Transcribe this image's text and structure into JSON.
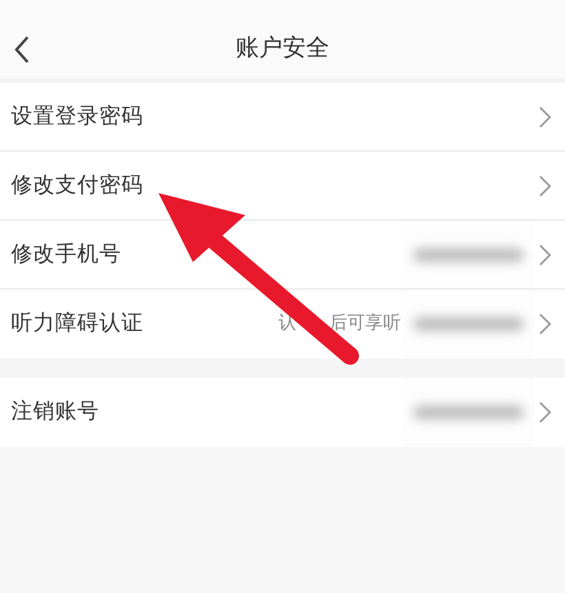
{
  "header": {
    "title": "账户安全"
  },
  "sections": [
    {
      "rows": [
        {
          "label": "设置登录密码",
          "redacted": false
        },
        {
          "label": "修改支付密码",
          "redacted": false
        },
        {
          "label": "修改手机号",
          "redacted": true
        },
        {
          "label": "听力障碍认证",
          "hint_parts": [
            "认",
            "后可享听"
          ],
          "redacted": true
        }
      ]
    },
    {
      "rows": [
        {
          "label": "注销账号",
          "redacted": true
        }
      ]
    }
  ],
  "annotation": {
    "kind": "arrow"
  }
}
